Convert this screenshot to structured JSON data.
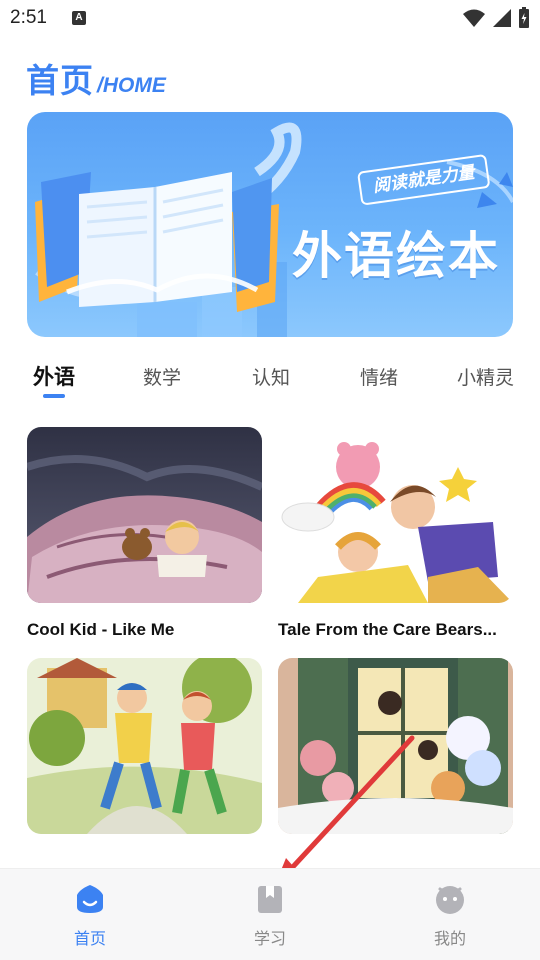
{
  "status_bar": {
    "time": "2:51",
    "notification_icon": "a-letter-icon",
    "icons": [
      "wifi-icon",
      "signal-icon",
      "battery-icon"
    ]
  },
  "header": {
    "title": "首页",
    "subtitle": "/HOME"
  },
  "banner": {
    "tag": "阅读就是力量",
    "title": "外语绘本",
    "illustration": "open-book-icon"
  },
  "tabs": [
    {
      "label": "外语",
      "active": true
    },
    {
      "label": "数学",
      "active": false
    },
    {
      "label": "认知",
      "active": false
    },
    {
      "label": "情绪",
      "active": false
    },
    {
      "label": "小精灵",
      "active": false
    }
  ],
  "books": [
    {
      "title": "Cool Kid - Like Me"
    },
    {
      "title": "Tale From the Care Bears..."
    },
    {
      "title": ""
    },
    {
      "title": ""
    }
  ],
  "bottom_nav": [
    {
      "label": "首页",
      "icon": "home-icon",
      "active": true
    },
    {
      "label": "学习",
      "icon": "bookmark-book-icon",
      "active": false
    },
    {
      "label": "我的",
      "icon": "profile-face-icon",
      "active": false
    }
  ],
  "colors": {
    "accent": "#3c82f2",
    "annotation_arrow": "#e03a3a",
    "nav_inactive": "#888888"
  }
}
